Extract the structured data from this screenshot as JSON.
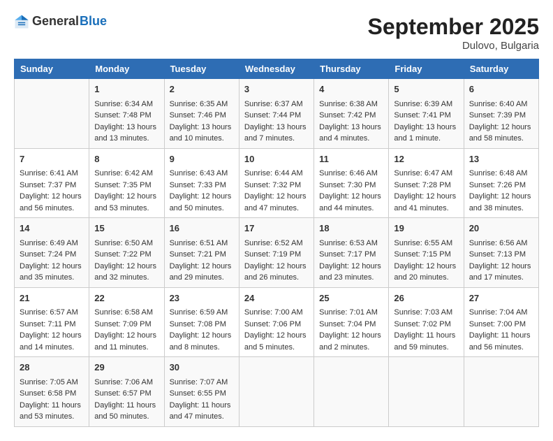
{
  "logo": {
    "text_general": "General",
    "text_blue": "Blue"
  },
  "title": "September 2025",
  "location": "Dulovo, Bulgaria",
  "weekdays": [
    "Sunday",
    "Monday",
    "Tuesday",
    "Wednesday",
    "Thursday",
    "Friday",
    "Saturday"
  ],
  "weeks": [
    [
      {
        "day": "",
        "sunrise": "",
        "sunset": "",
        "daylight": ""
      },
      {
        "day": "1",
        "sunrise": "Sunrise: 6:34 AM",
        "sunset": "Sunset: 7:48 PM",
        "daylight": "Daylight: 13 hours and 13 minutes."
      },
      {
        "day": "2",
        "sunrise": "Sunrise: 6:35 AM",
        "sunset": "Sunset: 7:46 PM",
        "daylight": "Daylight: 13 hours and 10 minutes."
      },
      {
        "day": "3",
        "sunrise": "Sunrise: 6:37 AM",
        "sunset": "Sunset: 7:44 PM",
        "daylight": "Daylight: 13 hours and 7 minutes."
      },
      {
        "day": "4",
        "sunrise": "Sunrise: 6:38 AM",
        "sunset": "Sunset: 7:42 PM",
        "daylight": "Daylight: 13 hours and 4 minutes."
      },
      {
        "day": "5",
        "sunrise": "Sunrise: 6:39 AM",
        "sunset": "Sunset: 7:41 PM",
        "daylight": "Daylight: 13 hours and 1 minute."
      },
      {
        "day": "6",
        "sunrise": "Sunrise: 6:40 AM",
        "sunset": "Sunset: 7:39 PM",
        "daylight": "Daylight: 12 hours and 58 minutes."
      }
    ],
    [
      {
        "day": "7",
        "sunrise": "Sunrise: 6:41 AM",
        "sunset": "Sunset: 7:37 PM",
        "daylight": "Daylight: 12 hours and 56 minutes."
      },
      {
        "day": "8",
        "sunrise": "Sunrise: 6:42 AM",
        "sunset": "Sunset: 7:35 PM",
        "daylight": "Daylight: 12 hours and 53 minutes."
      },
      {
        "day": "9",
        "sunrise": "Sunrise: 6:43 AM",
        "sunset": "Sunset: 7:33 PM",
        "daylight": "Daylight: 12 hours and 50 minutes."
      },
      {
        "day": "10",
        "sunrise": "Sunrise: 6:44 AM",
        "sunset": "Sunset: 7:32 PM",
        "daylight": "Daylight: 12 hours and 47 minutes."
      },
      {
        "day": "11",
        "sunrise": "Sunrise: 6:46 AM",
        "sunset": "Sunset: 7:30 PM",
        "daylight": "Daylight: 12 hours and 44 minutes."
      },
      {
        "day": "12",
        "sunrise": "Sunrise: 6:47 AM",
        "sunset": "Sunset: 7:28 PM",
        "daylight": "Daylight: 12 hours and 41 minutes."
      },
      {
        "day": "13",
        "sunrise": "Sunrise: 6:48 AM",
        "sunset": "Sunset: 7:26 PM",
        "daylight": "Daylight: 12 hours and 38 minutes."
      }
    ],
    [
      {
        "day": "14",
        "sunrise": "Sunrise: 6:49 AM",
        "sunset": "Sunset: 7:24 PM",
        "daylight": "Daylight: 12 hours and 35 minutes."
      },
      {
        "day": "15",
        "sunrise": "Sunrise: 6:50 AM",
        "sunset": "Sunset: 7:22 PM",
        "daylight": "Daylight: 12 hours and 32 minutes."
      },
      {
        "day": "16",
        "sunrise": "Sunrise: 6:51 AM",
        "sunset": "Sunset: 7:21 PM",
        "daylight": "Daylight: 12 hours and 29 minutes."
      },
      {
        "day": "17",
        "sunrise": "Sunrise: 6:52 AM",
        "sunset": "Sunset: 7:19 PM",
        "daylight": "Daylight: 12 hours and 26 minutes."
      },
      {
        "day": "18",
        "sunrise": "Sunrise: 6:53 AM",
        "sunset": "Sunset: 7:17 PM",
        "daylight": "Daylight: 12 hours and 23 minutes."
      },
      {
        "day": "19",
        "sunrise": "Sunrise: 6:55 AM",
        "sunset": "Sunset: 7:15 PM",
        "daylight": "Daylight: 12 hours and 20 minutes."
      },
      {
        "day": "20",
        "sunrise": "Sunrise: 6:56 AM",
        "sunset": "Sunset: 7:13 PM",
        "daylight": "Daylight: 12 hours and 17 minutes."
      }
    ],
    [
      {
        "day": "21",
        "sunrise": "Sunrise: 6:57 AM",
        "sunset": "Sunset: 7:11 PM",
        "daylight": "Daylight: 12 hours and 14 minutes."
      },
      {
        "day": "22",
        "sunrise": "Sunrise: 6:58 AM",
        "sunset": "Sunset: 7:09 PM",
        "daylight": "Daylight: 12 hours and 11 minutes."
      },
      {
        "day": "23",
        "sunrise": "Sunrise: 6:59 AM",
        "sunset": "Sunset: 7:08 PM",
        "daylight": "Daylight: 12 hours and 8 minutes."
      },
      {
        "day": "24",
        "sunrise": "Sunrise: 7:00 AM",
        "sunset": "Sunset: 7:06 PM",
        "daylight": "Daylight: 12 hours and 5 minutes."
      },
      {
        "day": "25",
        "sunrise": "Sunrise: 7:01 AM",
        "sunset": "Sunset: 7:04 PM",
        "daylight": "Daylight: 12 hours and 2 minutes."
      },
      {
        "day": "26",
        "sunrise": "Sunrise: 7:03 AM",
        "sunset": "Sunset: 7:02 PM",
        "daylight": "Daylight: 11 hours and 59 minutes."
      },
      {
        "day": "27",
        "sunrise": "Sunrise: 7:04 AM",
        "sunset": "Sunset: 7:00 PM",
        "daylight": "Daylight: 11 hours and 56 minutes."
      }
    ],
    [
      {
        "day": "28",
        "sunrise": "Sunrise: 7:05 AM",
        "sunset": "Sunset: 6:58 PM",
        "daylight": "Daylight: 11 hours and 53 minutes."
      },
      {
        "day": "29",
        "sunrise": "Sunrise: 7:06 AM",
        "sunset": "Sunset: 6:57 PM",
        "daylight": "Daylight: 11 hours and 50 minutes."
      },
      {
        "day": "30",
        "sunrise": "Sunrise: 7:07 AM",
        "sunset": "Sunset: 6:55 PM",
        "daylight": "Daylight: 11 hours and 47 minutes."
      },
      {
        "day": "",
        "sunrise": "",
        "sunset": "",
        "daylight": ""
      },
      {
        "day": "",
        "sunrise": "",
        "sunset": "",
        "daylight": ""
      },
      {
        "day": "",
        "sunrise": "",
        "sunset": "",
        "daylight": ""
      },
      {
        "day": "",
        "sunrise": "",
        "sunset": "",
        "daylight": ""
      }
    ]
  ]
}
